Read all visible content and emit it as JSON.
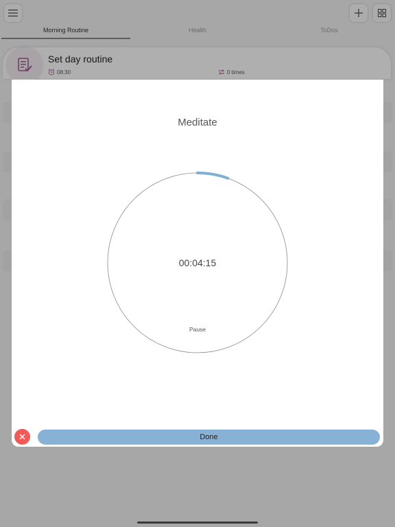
{
  "tabs": [
    {
      "label": "Morning Routine",
      "active": true
    },
    {
      "label": "Health",
      "active": false
    },
    {
      "label": "ToDos",
      "active": false
    }
  ],
  "card": {
    "title": "Set day routine",
    "time": "08:30",
    "repeat": "0 times",
    "icon": "checklist-icon",
    "accent": "#a65b91"
  },
  "modal": {
    "title": "Meditate",
    "timer": "00:04:15",
    "pause_label": "Pause",
    "done_label": "Done",
    "progress": 0.055,
    "progress_color": "#7fb0d4",
    "done_color": "#87b2d6",
    "close_color": "#f15a57"
  }
}
